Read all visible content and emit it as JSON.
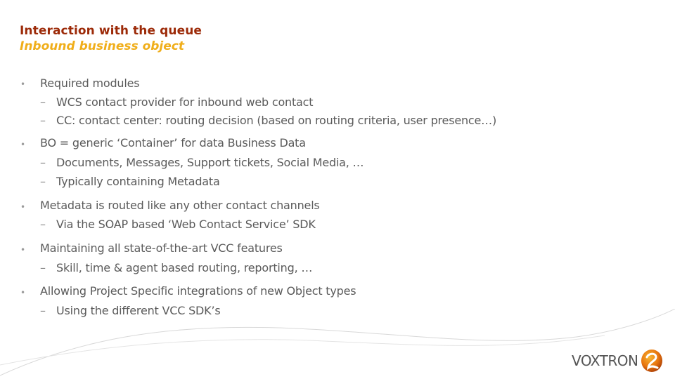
{
  "header": {
    "title": "Interaction with the queue",
    "subtitle": "Inbound business object"
  },
  "colors": {
    "title": "#9c2a08",
    "subtitle": "#f0ae1a",
    "body_text": "#5a5a5a",
    "logo_orange": "#e8750f"
  },
  "bullet_glyph": "•",
  "dash_glyph": "–",
  "bullets": [
    {
      "text": "Required modules",
      "sub": [
        "WCS contact provider for inbound web contact",
        "CC: contact center: routing decision (based on routing criteria, user presence…)"
      ]
    },
    {
      "text": "BO = generic ‘Container’ for data Business Data",
      "sub": [
        "Documents, Messages, Support tickets, Social Media, …",
        "Typically containing Metadata"
      ]
    },
    {
      "text": "Metadata is routed like any other contact channels",
      "sub": [
        "Via the SOAP based ‘Web Contact Service’ SDK"
      ]
    },
    {
      "text": "Maintaining all state-of-the-art VCC features",
      "sub": [
        "Skill, time & agent based routing, reporting, …"
      ]
    },
    {
      "text": "Allowing Project Specific integrations of new Object types",
      "sub": [
        "Using the different VCC SDK’s"
      ]
    }
  ],
  "logo": {
    "text": "VOXTRON",
    "icon": "voxtron-swirl-icon"
  }
}
